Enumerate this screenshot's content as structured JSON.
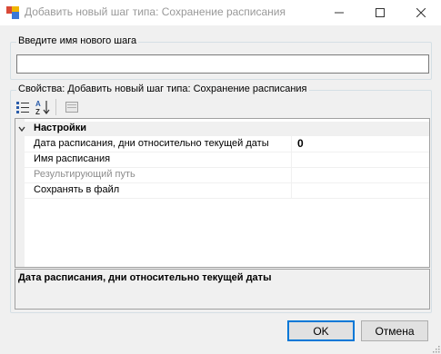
{
  "window": {
    "title": "Добавить новый шаг типа: Сохранение расписания",
    "icons": [
      "app-icon",
      "minimize-icon",
      "maximize-icon",
      "close-icon"
    ]
  },
  "name_group": {
    "legend": "Введите имя нового шага",
    "input_value": ""
  },
  "properties_group": {
    "legend": "Свойства: Добавить новый шаг типа: Сохранение расписания",
    "toolbar": [
      "categorized-view-icon",
      "alphabetical-sort-icon",
      "property-pages-icon"
    ],
    "category": "Настройки",
    "rows": [
      {
        "name": "Дата расписания, дни относительно текущей даты",
        "value": "0",
        "disabled": false
      },
      {
        "name": "Имя расписания",
        "value": "",
        "disabled": false
      },
      {
        "name": "Результирующий путь",
        "value": "",
        "disabled": true
      },
      {
        "name": "Сохранять в файл",
        "value": "",
        "disabled": false
      }
    ],
    "description_title": "Дата расписания, дни относительно текущей даты"
  },
  "buttons": {
    "ok": "OK",
    "cancel": "Отмена"
  }
}
